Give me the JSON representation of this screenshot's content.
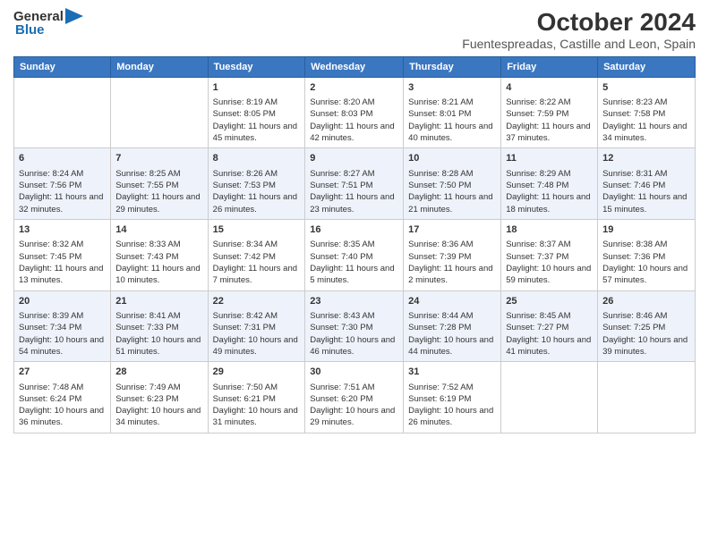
{
  "logo": {
    "general": "General",
    "blue": "Blue",
    "icon": "▶"
  },
  "title": "October 2024",
  "subtitle": "Fuentespreadas, Castille and Leon, Spain",
  "days_of_week": [
    "Sunday",
    "Monday",
    "Tuesday",
    "Wednesday",
    "Thursday",
    "Friday",
    "Saturday"
  ],
  "weeks": [
    [
      {
        "day": "",
        "content": ""
      },
      {
        "day": "",
        "content": ""
      },
      {
        "day": "1",
        "content": "Sunrise: 8:19 AM\nSunset: 8:05 PM\nDaylight: 11 hours and 45 minutes."
      },
      {
        "day": "2",
        "content": "Sunrise: 8:20 AM\nSunset: 8:03 PM\nDaylight: 11 hours and 42 minutes."
      },
      {
        "day": "3",
        "content": "Sunrise: 8:21 AM\nSunset: 8:01 PM\nDaylight: 11 hours and 40 minutes."
      },
      {
        "day": "4",
        "content": "Sunrise: 8:22 AM\nSunset: 7:59 PM\nDaylight: 11 hours and 37 minutes."
      },
      {
        "day": "5",
        "content": "Sunrise: 8:23 AM\nSunset: 7:58 PM\nDaylight: 11 hours and 34 minutes."
      }
    ],
    [
      {
        "day": "6",
        "content": "Sunrise: 8:24 AM\nSunset: 7:56 PM\nDaylight: 11 hours and 32 minutes."
      },
      {
        "day": "7",
        "content": "Sunrise: 8:25 AM\nSunset: 7:55 PM\nDaylight: 11 hours and 29 minutes."
      },
      {
        "day": "8",
        "content": "Sunrise: 8:26 AM\nSunset: 7:53 PM\nDaylight: 11 hours and 26 minutes."
      },
      {
        "day": "9",
        "content": "Sunrise: 8:27 AM\nSunset: 7:51 PM\nDaylight: 11 hours and 23 minutes."
      },
      {
        "day": "10",
        "content": "Sunrise: 8:28 AM\nSunset: 7:50 PM\nDaylight: 11 hours and 21 minutes."
      },
      {
        "day": "11",
        "content": "Sunrise: 8:29 AM\nSunset: 7:48 PM\nDaylight: 11 hours and 18 minutes."
      },
      {
        "day": "12",
        "content": "Sunrise: 8:31 AM\nSunset: 7:46 PM\nDaylight: 11 hours and 15 minutes."
      }
    ],
    [
      {
        "day": "13",
        "content": "Sunrise: 8:32 AM\nSunset: 7:45 PM\nDaylight: 11 hours and 13 minutes."
      },
      {
        "day": "14",
        "content": "Sunrise: 8:33 AM\nSunset: 7:43 PM\nDaylight: 11 hours and 10 minutes."
      },
      {
        "day": "15",
        "content": "Sunrise: 8:34 AM\nSunset: 7:42 PM\nDaylight: 11 hours and 7 minutes."
      },
      {
        "day": "16",
        "content": "Sunrise: 8:35 AM\nSunset: 7:40 PM\nDaylight: 11 hours and 5 minutes."
      },
      {
        "day": "17",
        "content": "Sunrise: 8:36 AM\nSunset: 7:39 PM\nDaylight: 11 hours and 2 minutes."
      },
      {
        "day": "18",
        "content": "Sunrise: 8:37 AM\nSunset: 7:37 PM\nDaylight: 10 hours and 59 minutes."
      },
      {
        "day": "19",
        "content": "Sunrise: 8:38 AM\nSunset: 7:36 PM\nDaylight: 10 hours and 57 minutes."
      }
    ],
    [
      {
        "day": "20",
        "content": "Sunrise: 8:39 AM\nSunset: 7:34 PM\nDaylight: 10 hours and 54 minutes."
      },
      {
        "day": "21",
        "content": "Sunrise: 8:41 AM\nSunset: 7:33 PM\nDaylight: 10 hours and 51 minutes."
      },
      {
        "day": "22",
        "content": "Sunrise: 8:42 AM\nSunset: 7:31 PM\nDaylight: 10 hours and 49 minutes."
      },
      {
        "day": "23",
        "content": "Sunrise: 8:43 AM\nSunset: 7:30 PM\nDaylight: 10 hours and 46 minutes."
      },
      {
        "day": "24",
        "content": "Sunrise: 8:44 AM\nSunset: 7:28 PM\nDaylight: 10 hours and 44 minutes."
      },
      {
        "day": "25",
        "content": "Sunrise: 8:45 AM\nSunset: 7:27 PM\nDaylight: 10 hours and 41 minutes."
      },
      {
        "day": "26",
        "content": "Sunrise: 8:46 AM\nSunset: 7:25 PM\nDaylight: 10 hours and 39 minutes."
      }
    ],
    [
      {
        "day": "27",
        "content": "Sunrise: 7:48 AM\nSunset: 6:24 PM\nDaylight: 10 hours and 36 minutes."
      },
      {
        "day": "28",
        "content": "Sunrise: 7:49 AM\nSunset: 6:23 PM\nDaylight: 10 hours and 34 minutes."
      },
      {
        "day": "29",
        "content": "Sunrise: 7:50 AM\nSunset: 6:21 PM\nDaylight: 10 hours and 31 minutes."
      },
      {
        "day": "30",
        "content": "Sunrise: 7:51 AM\nSunset: 6:20 PM\nDaylight: 10 hours and 29 minutes."
      },
      {
        "day": "31",
        "content": "Sunrise: 7:52 AM\nSunset: 6:19 PM\nDaylight: 10 hours and 26 minutes."
      },
      {
        "day": "",
        "content": ""
      },
      {
        "day": "",
        "content": ""
      }
    ]
  ]
}
